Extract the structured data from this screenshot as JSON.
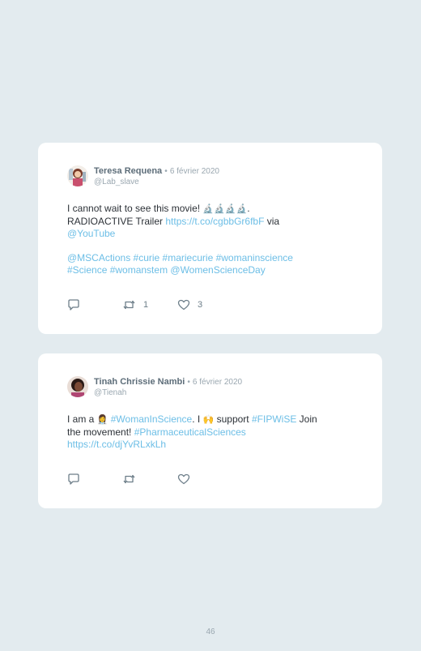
{
  "tweets": [
    {
      "name": "Teresa Requena",
      "sep": "•",
      "date": "6 février 2020",
      "handle": "@Lab_slave",
      "line1_a": "I cannot wait to see this movie! ",
      "line1_emoji": "🔬🔬🔬🔬",
      "line1_b": ".",
      "line2_a": "RADIOACTIVE Trailer ",
      "line2_link": "https://t.co/cgbbGr6fbF",
      "line2_b": " via",
      "line3_link": "@YouTube",
      "line4": "@MSCActions #curie #mariecurie #womaninscience",
      "line5": "#Science #womanstem @WomenScienceDay",
      "retweets": "1",
      "likes": "3"
    },
    {
      "name": "Tinah Chrissie Nambi",
      "sep": "•",
      "date": "6 février 2020",
      "handle": "@Tienah",
      "line1_a": "I am a ",
      "line1_emoji1": "👩‍⚕️",
      "line1_link1": "#WomanInScience",
      "line1_b": ". I ",
      "line1_emoji2": "🙌",
      "line1_c": " support ",
      "line1_link2": "#FIPWiSE",
      "line1_d": " Join",
      "line2_a": "the movement! ",
      "line2_link": "#PharmaceuticalSciences",
      "line3_link": "https://t.co/djYvRLxkLh",
      "retweets": "",
      "likes": ""
    }
  ],
  "footer": {
    "page_number": "46"
  },
  "colors": {
    "background": "#e3ebef",
    "link": "#6cbee6",
    "card": "#ffffff"
  }
}
